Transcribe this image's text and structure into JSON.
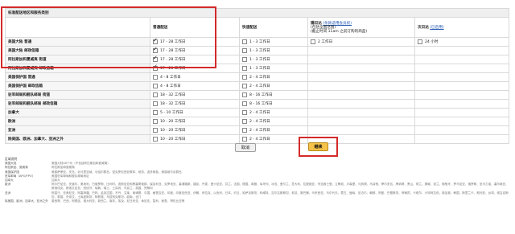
{
  "table": {
    "title": "标准配送地区和服务类别",
    "headers": {
      "standard": "普通配送",
      "express": "快速配送",
      "priority_prefix": "隔日达",
      "priority_link": "(条款适用会员权)",
      "priority_note1": "(包括全国范围)",
      "priority_note2": "(截止时间 11am 之前订购的商品)",
      "nextday_prefix": "次日达",
      "nextday_link": "(已启用)"
    },
    "rows": [
      {
        "region": "美国大陆 普通",
        "std": "17 - 28 工作日",
        "std_on": true,
        "exp": "1 - 3 工作日",
        "pri": "2 工作日",
        "nxt": "24 小时"
      },
      {
        "region": "美国大陆 邮政信箱",
        "std": "17 - 28 工作日",
        "std_on": true,
        "exp": "1 - 3 工作日",
        "pri": "",
        "nxt": ""
      },
      {
        "region": "阿拉斯加和夏威夷 街道",
        "std": "17 - 28 工作日",
        "std_on": true,
        "exp": "1 - 3 工作日",
        "pri": "",
        "nxt": ""
      },
      {
        "region": "阿拉斯加和夏威夷 邮政信箱",
        "std": "17 - 28 工作日",
        "std_on": true,
        "exp": "1 - 3 工作日",
        "pri": "",
        "nxt": ""
      },
      {
        "region": "美国保护国 普通",
        "std": "4 - 8 工作日",
        "std_on": false,
        "exp": "2 - 4 工作日",
        "pri": "",
        "nxt": ""
      },
      {
        "region": "美国保护国 邮政信箱",
        "std": "4 - 8 工作日",
        "std_on": false,
        "exp": "2 - 4 工作日",
        "pri": "",
        "nxt": ""
      },
      {
        "region": "驻军邮局和舰队邮局 街道",
        "std": "18 - 32 工作日",
        "std_on": false,
        "exp": "8 - 16 工作日",
        "pri": "",
        "nxt": ""
      },
      {
        "region": "驻军邮局和舰队邮局 邮政信箱",
        "std": "18 - 32 工作日",
        "std_on": false,
        "exp": "8 - 16 工作日",
        "pri": "",
        "nxt": ""
      },
      {
        "region": "加拿大",
        "std": "5 - 10 工作日",
        "std_on": false,
        "exp": "2 - 4 工作日",
        "pri": "",
        "nxt": ""
      },
      {
        "region": "欧洲",
        "std": "10 - 20 工作日",
        "std_on": false,
        "exp": "2 - 4 工作日",
        "pri": "",
        "nxt": ""
      },
      {
        "region": "亚洲",
        "std": "10 - 20 工作日",
        "std_on": false,
        "exp": "2 - 4 工作日",
        "pri": "",
        "nxt": ""
      },
      {
        "region": "除美国、欧洲、加拿大、亚洲之外",
        "std": "10 - 20 工作日",
        "std_on": false,
        "exp": "2 - 4 工作日",
        "pri": "",
        "nxt": ""
      }
    ]
  },
  "buttons": {
    "cancel": "取消",
    "continue": "继续"
  },
  "info": {
    "heading": "区域说明",
    "items": [
      {
        "k": "美国大陆",
        "v": "美国大陆48个州（不包括阿拉斯加和夏威夷）"
      },
      {
        "k": "阿拉斯加、夏威夷",
        "v": "阿拉斯加和夏威夷"
      },
      {
        "k": "美国保护国",
        "v": "美属萨摩亚、关岛、北马里亚纳、马绍尔群岛、密克罗尼西亚联邦、帕劳、波多黎各、美属维尔京群岛"
      },
      {
        "k": "驻军邮局（APO/FPO）",
        "v": "美国驻军邮局和舰队邮局地址"
      },
      {
        "k": "加拿大",
        "v": "加拿大"
      },
      {
        "k": "欧洲",
        "v": "阿尔巴尼亚、安道尔、奥地利、白俄罗斯、比利时、波斯尼亚和黑塞哥维那、保加利亚、克罗地亚、塞浦路斯、捷克、丹麦、爱沙尼亚、芬兰、法国、德国、希腊、匈牙利、冰岛、爱尔兰、意大利、拉脱维亚、列支敦士登、立陶宛、卢森堡、马其顿、马耳他、摩尔多瓦、摩纳哥、黑山、荷兰、挪威、波兰、葡萄牙、罗马尼亚、俄罗斯、圣马力诺、塞尔维亚、斯洛伐克、斯洛文尼亚、西班牙、瑞典、瑞士、土耳其、乌克兰、英国、梵蒂冈"
      },
      {
        "k": "亚洲",
        "v": "阿富汗、亚美尼亚、阿塞拜疆、巴林、孟加拉国、不丹、文莱、柬埔寨、中国、格鲁吉亚、印度、印度尼西亚、伊朗、伊拉克、以色列、日本、约旦、哈萨克斯坦、科威特、吉尔吉斯斯坦、老挝、黎巴嫩、马来西亚、马尔代夫、蒙古、缅甸、尼泊尔、朝鲜、阿曼、巴基斯坦、菲律宾、卡塔尔、沙特阿拉伯、新加坡、韩国、斯里兰卡、叙利亚、台湾、塔吉克斯坦、泰国、东帝汶、土库曼斯坦、阿联酋、乌兹别克斯坦、越南、也门"
      },
      {
        "k": "除美国、欧洲、加拿大、亚洲之外",
        "v": "墨西哥、巴西、阿根廷、澳大利亚、新西兰、南非、埃及、尼日利亚、肯尼亚、智利、秘鲁、哥伦比亚等"
      }
    ]
  }
}
